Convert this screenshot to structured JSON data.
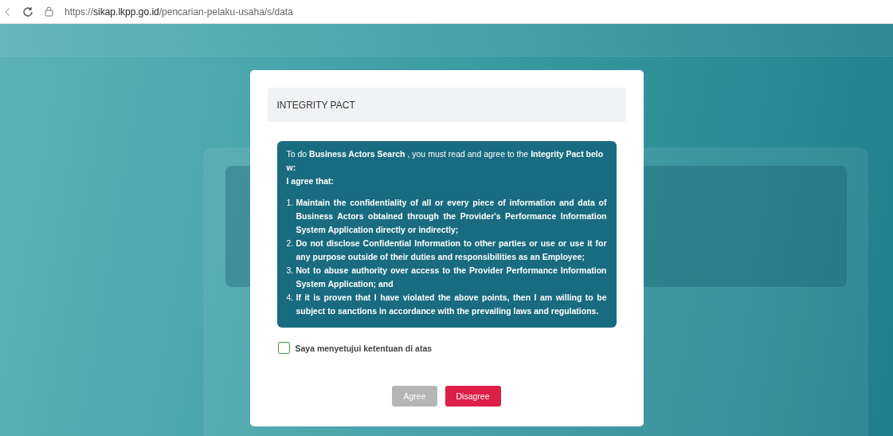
{
  "browser": {
    "url": "https://**sikap.lkpp.go.id**/pencarian-pelaku-usaha/s/data"
  },
  "modal": {
    "title": "INTEGRITY PACT",
    "intro": "To do **Business Actors Search** , you must read and agree to the **Integrity Pact below:**",
    "lead": "I agree that:",
    "items": [
      {
        "number": "1.",
        "text": "Maintain the confidentiality of all or every piece of information and data of Business Actors obtained through the Provider's Performance Information System Application directly or indirectly;"
      },
      {
        "number": "2.",
        "text": "Do not disclose Confidential Information to other parties or use or use it for any purpose outside of their duties and responsibilities as an Employee;"
      },
      {
        "number": "3.",
        "text": "Not to abuse authority over access to the Provider Performance Information System Application; and"
      },
      {
        "number": "4.",
        "text": "If it is proven that I have violated the above points, then I am willing to be subject to sanctions in accordance with the prevailing laws and regulations."
      }
    ],
    "consent": {
      "label": "Saya menyetujui ketentuan di atas",
      "checked": false
    },
    "buttons": [
      {
        "label": "Agree",
        "kind": "primary",
        "disabled": true
      },
      {
        "label": "Disagree",
        "kind": "danger",
        "disabled": false
      }
    ]
  }
}
